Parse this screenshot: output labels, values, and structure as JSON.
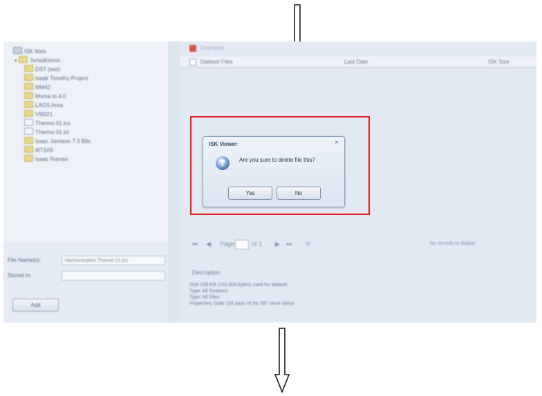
{
  "tree": {
    "items": [
      {
        "label": "ISK Web",
        "icon": "root-icon",
        "indent": 0,
        "expander": ""
      },
      {
        "label": "Jurisdictions",
        "icon": "folder-icon",
        "indent": 1,
        "expander": "▾"
      },
      {
        "label": "DST (test)",
        "icon": "folder-icon",
        "indent": 2,
        "expander": ""
      },
      {
        "label": "Isaak Timothy Project",
        "icon": "folder-icon",
        "indent": 2,
        "expander": ""
      },
      {
        "label": "MM42",
        "icon": "folder-icon",
        "indent": 2,
        "expander": ""
      },
      {
        "label": "Moma to 4.0",
        "icon": "folder-icon",
        "indent": 2,
        "expander": ""
      },
      {
        "label": "LAOS Area",
        "icon": "folder-icon",
        "indent": 2,
        "expander": ""
      },
      {
        "label": "VI0021",
        "icon": "folder-icon",
        "indent": 2,
        "expander": ""
      },
      {
        "label": "Thermo 01.lcs",
        "icon": "document-icon",
        "indent": 2,
        "expander": ""
      },
      {
        "label": "Thermo 01.lst",
        "icon": "document-icon",
        "indent": 2,
        "expander": ""
      },
      {
        "label": "Isaac Jamison 7.3 Bits",
        "icon": "folder-icon",
        "indent": 2,
        "expander": ""
      },
      {
        "label": "MTS09",
        "icon": "folder-icon",
        "indent": 2,
        "expander": ""
      },
      {
        "label": "Isaac Roman",
        "icon": "folder-icon",
        "indent": 2,
        "expander": ""
      }
    ]
  },
  "properties": {
    "file_name_label": "File Name(s):",
    "file_name_value": "Harmonization Thermo 01.lcs",
    "stored_in_label": "Stored in:",
    "stored_in_value": "",
    "add_button": "Add"
  },
  "right": {
    "header_text": "Overview",
    "columns": [
      "Dataset Files",
      "Last Date",
      "ISK Size"
    ]
  },
  "pager": {
    "first": "⏮",
    "prev": "◀",
    "page_label": "Page",
    "of_text": "of 1",
    "next": "▶",
    "last": "⏭",
    "refresh": "⟳",
    "status": "No records to display"
  },
  "description": {
    "title": "Description",
    "lines": [
      "Size 158 KB (161,904 bytes) used for dataset",
      "Type: All Systems",
      "Type: All Files",
      "Properties: Date 156 pass of the 587 since latest"
    ]
  },
  "dialog": {
    "title": "ISK Viewer",
    "close": "×",
    "message": "Are you sure to delete file this?",
    "yes_label": "Yes",
    "no_label": "No",
    "icon": "question-icon"
  },
  "colors": {
    "highlight": "#e02020",
    "background": "#dde5ef"
  }
}
